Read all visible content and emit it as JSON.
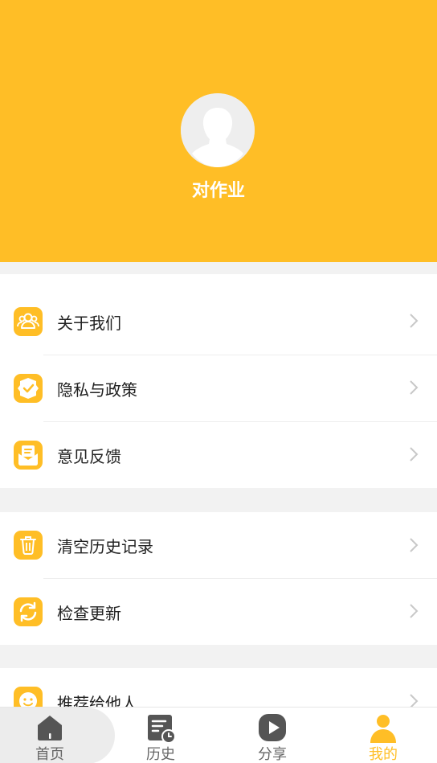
{
  "profile": {
    "username": "对作业"
  },
  "menu": {
    "group1": [
      {
        "label": "关于我们",
        "icon": "users-icon"
      },
      {
        "label": "隐私与政策",
        "icon": "shield-check-icon"
      },
      {
        "label": "意见反馈",
        "icon": "feedback-icon"
      }
    ],
    "group2": [
      {
        "label": "清空历史记录",
        "icon": "trash-icon"
      },
      {
        "label": "检查更新",
        "icon": "refresh-icon"
      }
    ],
    "group3": [
      {
        "label": "推荐给他人",
        "icon": "smile-icon"
      }
    ]
  },
  "tabbar": {
    "items": [
      {
        "label": "首页",
        "icon": "home-icon",
        "active": false
      },
      {
        "label": "历史",
        "icon": "history-icon",
        "active": false
      },
      {
        "label": "分享",
        "icon": "play-icon",
        "active": false
      },
      {
        "label": "我的",
        "icon": "person-icon",
        "active": true
      }
    ]
  },
  "colors": {
    "accent": "#ffbe26",
    "inactive": "#666666",
    "text": "#222222"
  }
}
